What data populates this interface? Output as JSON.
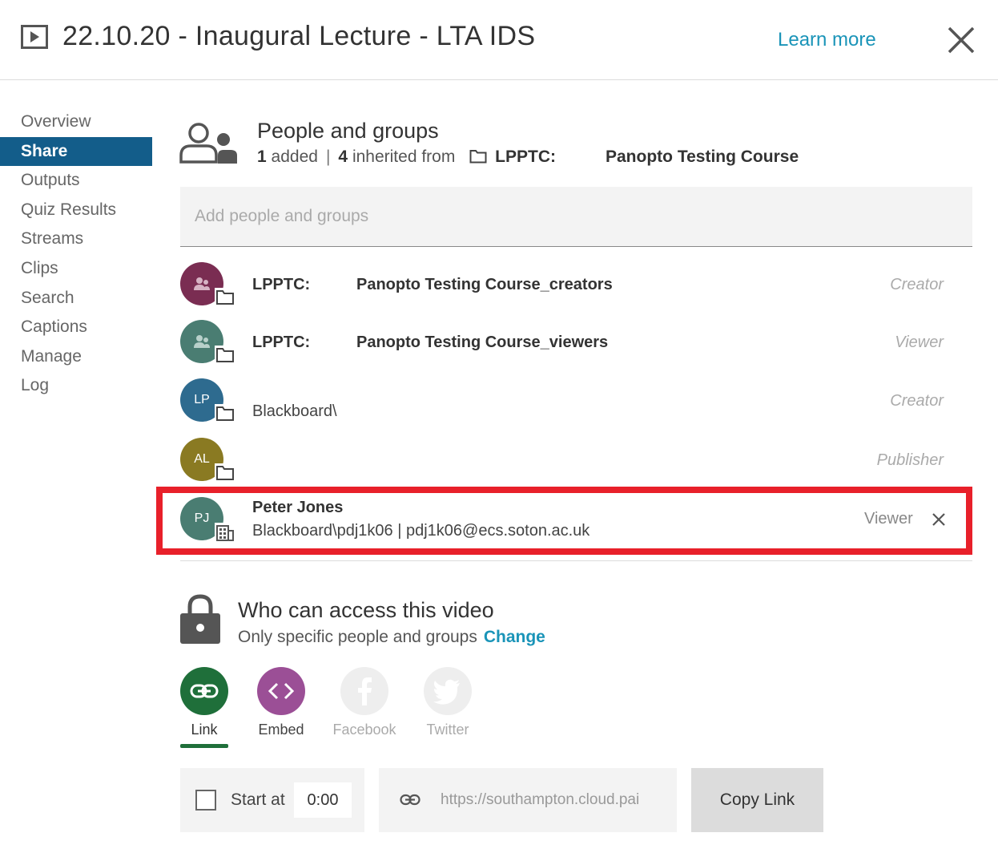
{
  "header": {
    "title": "22.10.20 - Inaugural Lecture - LTA IDS",
    "learn_more": "Learn more"
  },
  "sidebar": {
    "items": [
      {
        "label": "Overview",
        "active": false
      },
      {
        "label": "Share",
        "active": true
      },
      {
        "label": "Outputs",
        "active": false
      },
      {
        "label": "Quiz Results",
        "active": false
      },
      {
        "label": "Streams",
        "active": false
      },
      {
        "label": "Clips",
        "active": false
      },
      {
        "label": "Search",
        "active": false
      },
      {
        "label": "Captions",
        "active": false
      },
      {
        "label": "Manage",
        "active": false
      },
      {
        "label": "Log",
        "active": false
      }
    ]
  },
  "people": {
    "title": "People and groups",
    "added_count": "1",
    "added_label": "added",
    "separator": "|",
    "inherited_count": "4",
    "inherited_label": "inherited from",
    "course_prefix": "LPPTC:",
    "course_name": "Panopto Testing Course",
    "add_placeholder": "Add people and groups"
  },
  "entries": [
    {
      "prefix": "LPPTC:",
      "name": "Panopto Testing Course_creators",
      "role": "Creator",
      "avatar_color": "#7a2d52"
    },
    {
      "prefix": "LPPTC:",
      "name": "Panopto Testing Course_viewers",
      "role": "Viewer",
      "avatar_color": "#4a7d72"
    },
    {
      "initials": "LP",
      "secondary": "Blackboard\\",
      "role": "Creator",
      "avatar_color": "#2e6b8f"
    },
    {
      "initials": "AL",
      "role": "Publisher",
      "avatar_color": "#8a7a22"
    }
  ],
  "highlighted_entry": {
    "initials": "PJ",
    "name": "Peter Jones",
    "detail": "Blackboard\\pdj1k06 | pdj1k06@ecs.soton.ac.uk",
    "role": "Viewer",
    "avatar_color": "#4a7d72",
    "highlight_color": "#e8202a"
  },
  "access": {
    "title": "Who can access this video",
    "subtitle": "Only specific people and groups",
    "change_label": "Change"
  },
  "share_options": [
    {
      "label": "Link",
      "icon": "link-icon",
      "color": "#1f6f3a",
      "enabled": true
    },
    {
      "label": "Embed",
      "icon": "embed-icon",
      "color": "#9b4f96",
      "enabled": true
    },
    {
      "label": "Facebook",
      "icon": "facebook-icon",
      "color": "#eeeeee",
      "enabled": false
    },
    {
      "label": "Twitter",
      "icon": "twitter-icon",
      "color": "#eeeeee",
      "enabled": false
    }
  ],
  "bottom": {
    "start_at_label": "Start at",
    "start_time": "0:00",
    "url": "https://southampton.cloud.pai",
    "copy_label": "Copy Link"
  },
  "colors": {
    "active_nav": "#135d8a",
    "link_accent": "#1a94b8"
  }
}
